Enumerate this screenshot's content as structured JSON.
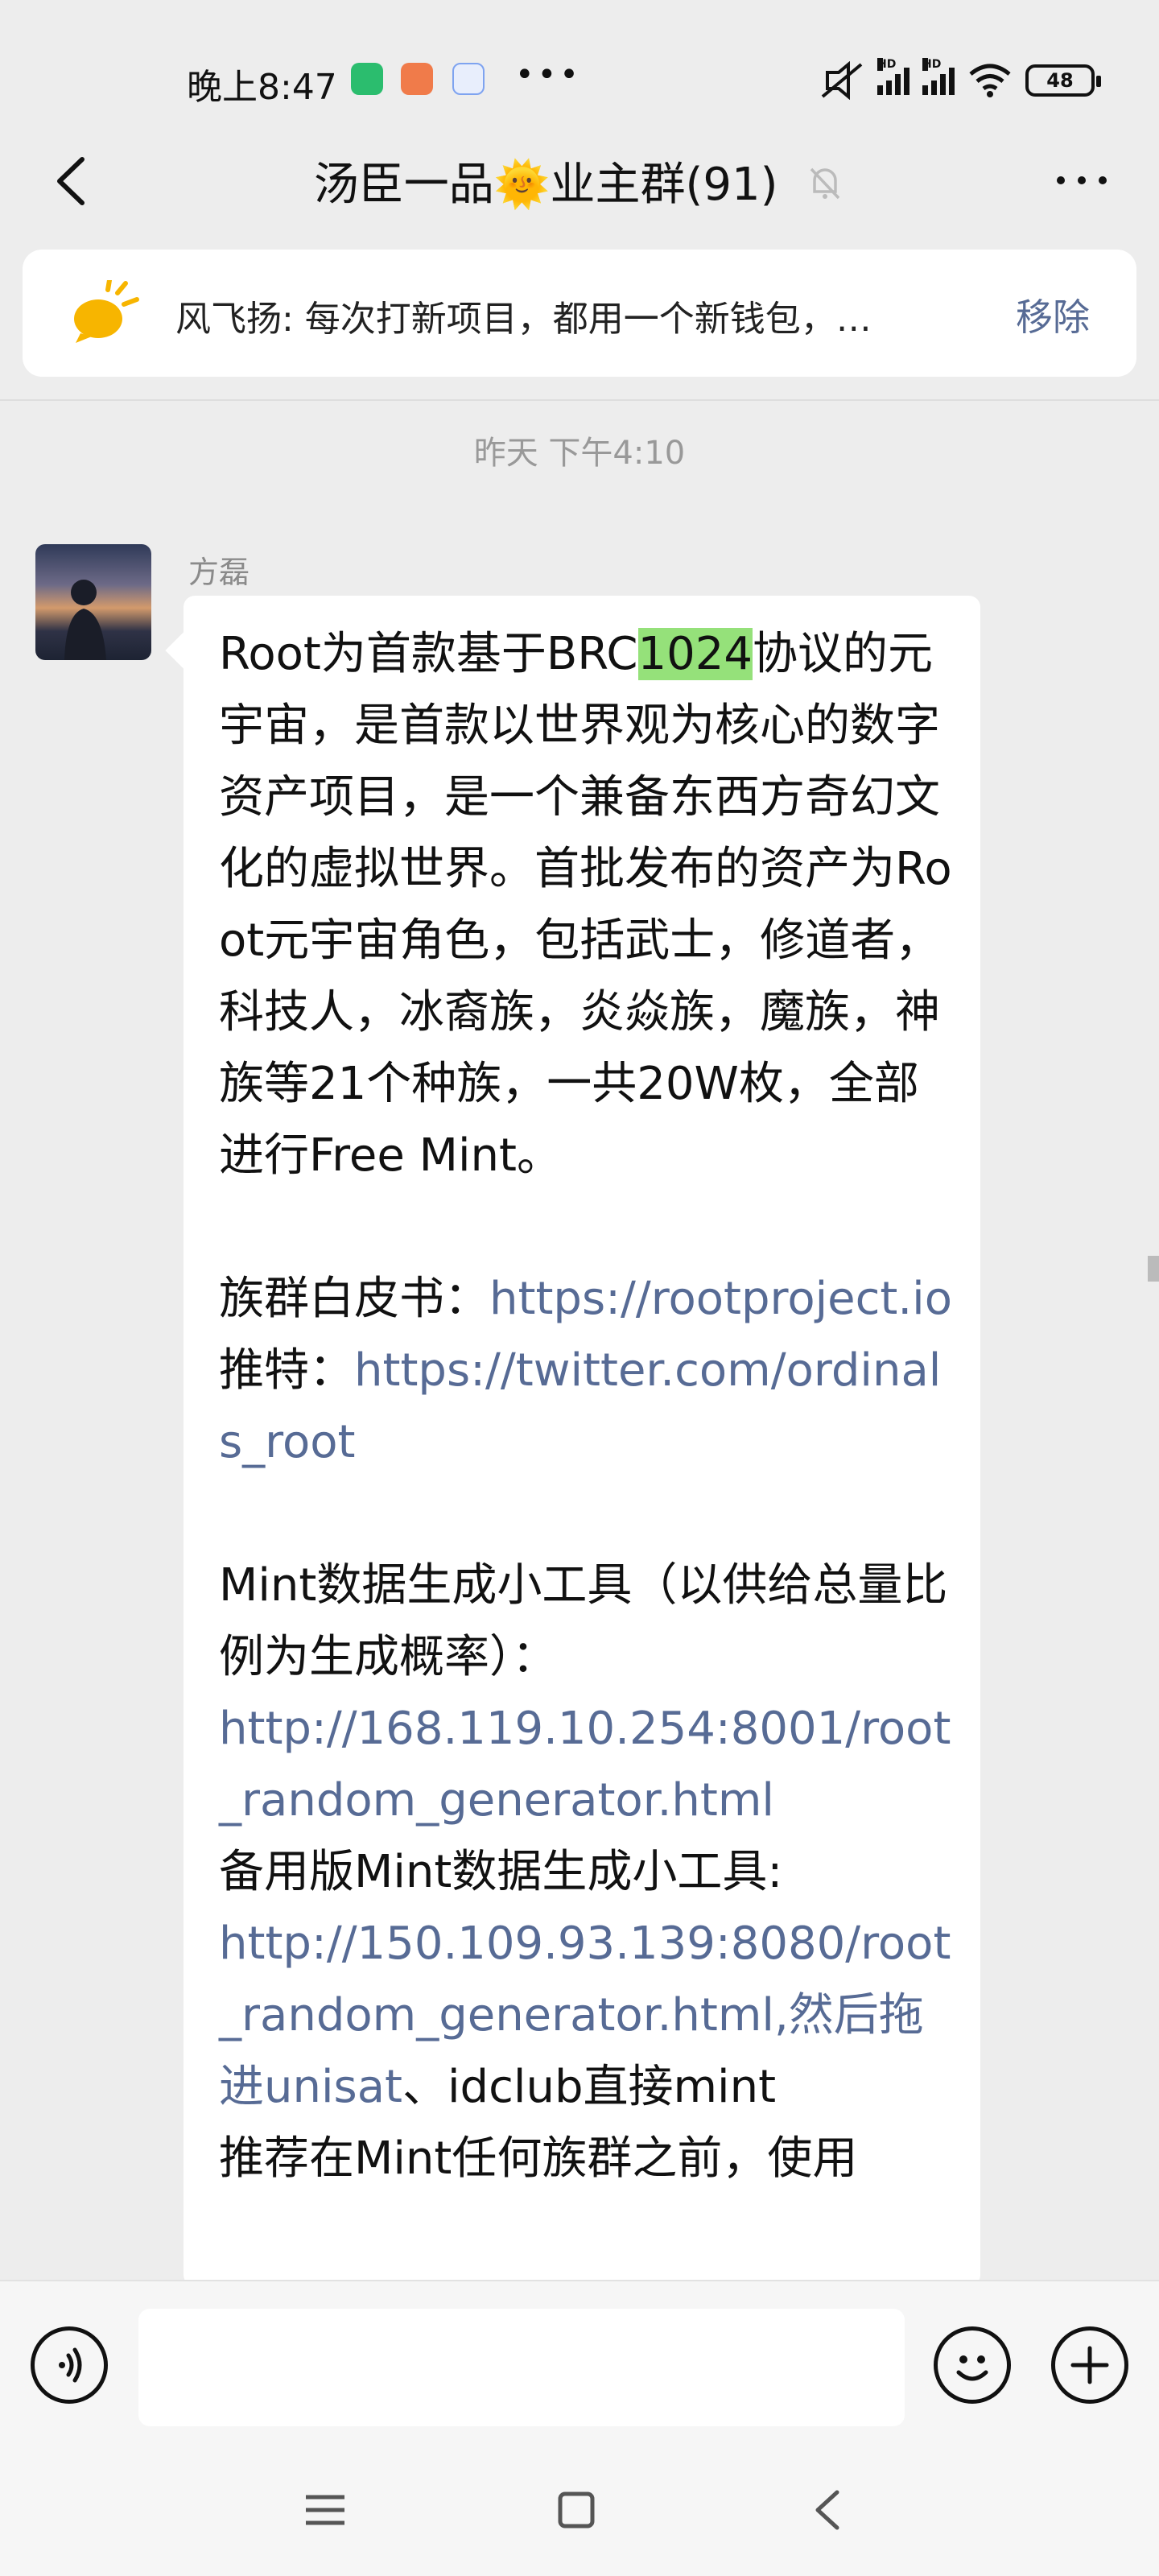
{
  "status_bar": {
    "time": "晚上8:47",
    "dots": "•••",
    "battery": "48",
    "hd1": "HD",
    "hd2": "HD"
  },
  "header": {
    "title": "汤臣一品🌞业主群(91)"
  },
  "pinned": {
    "text": "风飞扬: 每次打新项目，都用一个新钱包，…",
    "remove_label": "移除"
  },
  "timestamp": "昨天 下午4:10",
  "message": {
    "sender": "方磊",
    "pre": "Root为首款基于BRC",
    "highlight": "1024",
    "mid1": "协议的元宇宙，是首款以世界观为核心的数字资产项目，是一个兼备东西方奇幻文化的虚拟世界。首批发布的资产为Root元宇宙角色，包括武士，修道者，科技人，冰裔族，炎焱族，魔族，神族等21个种族，一共20W枚，全部进行Free Mint。\n\n族群白皮书：",
    "link1": "https://rootproject.io",
    "mid2": "\n推特：",
    "link2": "https://twitter.com/ordinals_root",
    "mid3": "\n\nMint数据生成小工具（以供给总量比例为生成概率）：\n",
    "link3": "http://168.119.10.254:8001/root_random_generator.html",
    "mid4": "\n备用版Mint数据生成小工具:\n",
    "link4": "http://150.109.93.139:8080/root_random_generator.html,然后拖进unisat",
    "mid5": "、idclub直接mint\n推荐在Mint任何族群之前，使用"
  },
  "icons": {
    "back": "back-arrow-icon",
    "more": "more-dots-icon",
    "mute": "bell-off-icon",
    "pinned": "megaphone-icon",
    "voice": "voice-icon",
    "emoji": "emoji-icon",
    "plus": "plus-icon"
  }
}
